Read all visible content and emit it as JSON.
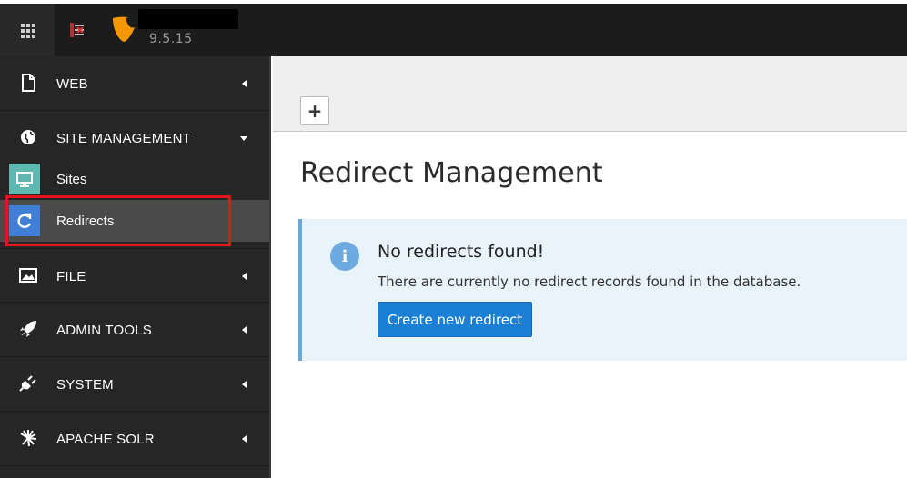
{
  "header": {
    "version": "9.5.15"
  },
  "sidebar": {
    "groups": [
      {
        "label": "WEB",
        "icon": "file-icon"
      },
      {
        "label": "SITE MANAGEMENT",
        "icon": "globe-icon"
      },
      {
        "label": "FILE",
        "icon": "image-icon"
      },
      {
        "label": "ADMIN TOOLS",
        "icon": "rocket-icon"
      },
      {
        "label": "SYSTEM",
        "icon": "plug-icon"
      },
      {
        "label": "APACHE SOLR",
        "icon": "solr-icon"
      }
    ],
    "site_management_items": [
      {
        "label": "Sites",
        "icon": "sites-monitor-icon"
      },
      {
        "label": "Redirects",
        "icon": "redirect-icon"
      }
    ]
  },
  "docheader": {
    "add_label": "+"
  },
  "main": {
    "title": "Redirect Management",
    "info": {
      "title": "No redirects found!",
      "text": "There are currently no redirect records found in the database.",
      "button": "Create new redirect"
    }
  },
  "colors": {
    "topbar": "#1c1c1c",
    "sidebar": "#262626",
    "active_item": "#4a4a4a",
    "highlight_border": "#e3151a",
    "info_bg": "#e9f3fb",
    "primary_button": "#1b7fd6"
  }
}
